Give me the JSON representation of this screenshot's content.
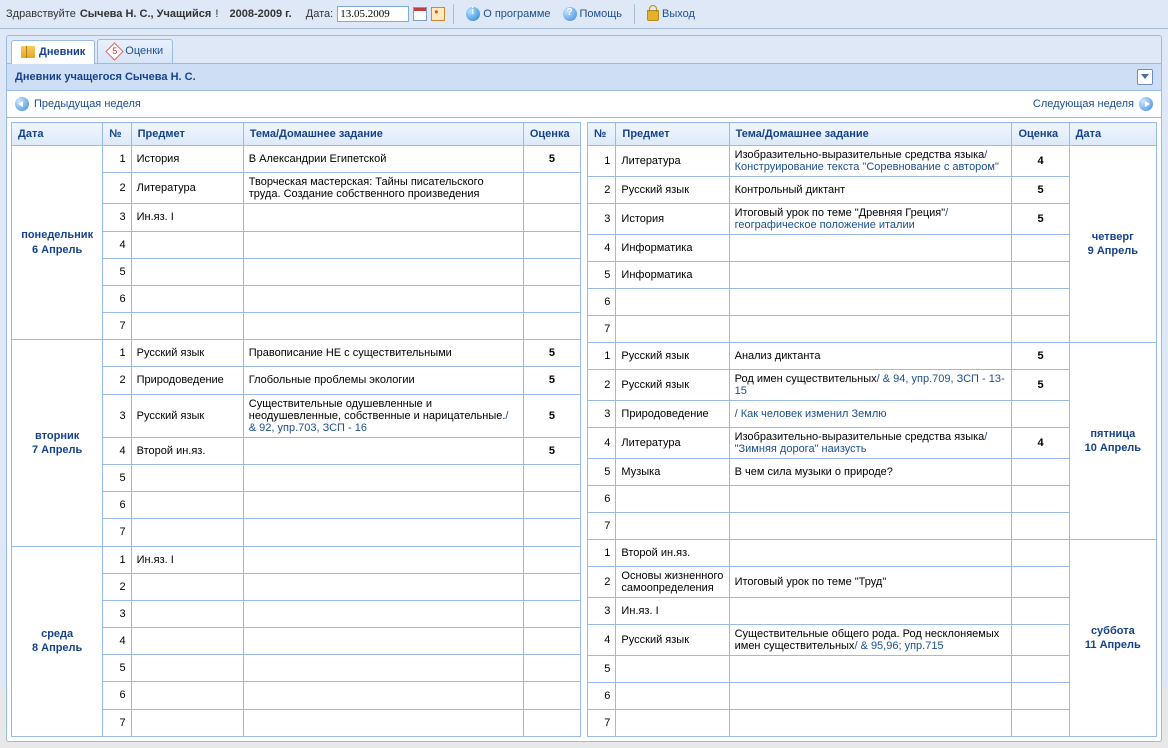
{
  "topbar": {
    "greeting_pre": "Здравствуйте ",
    "user": "Сычева Н. С., Учащийся",
    "greeting_post": "!",
    "year": "2008-2009 г.",
    "date_label": "Дата:",
    "date_value": "13.05.2009",
    "about": "О программе",
    "help": "Помощь",
    "exit": "Выход"
  },
  "tabs": {
    "diary": "Дневник",
    "grades": "Оценки"
  },
  "panel": {
    "title": "Дневник учащегося Сычева Н. С."
  },
  "nav": {
    "prev": "Предыдущая неделя",
    "next": "Следующая неделя"
  },
  "cols": {
    "date": "Дата",
    "num": "№",
    "subj": "Предмет",
    "topic": "Тема/Домашнее задание",
    "grade": "Оценка"
  },
  "left": [
    {
      "day": "понедельник",
      "date": "6 Апрель",
      "rows": [
        {
          "n": 1,
          "s": "История",
          "t": "В Александрии Египетской",
          "g": "5"
        },
        {
          "n": 2,
          "s": "Литература",
          "t": "Творческая мастерская: Тайны писательского труда. Создание собственного произведения",
          "g": ""
        },
        {
          "n": 3,
          "s": "Ин.яз. I",
          "t": "",
          "g": ""
        },
        {
          "n": 4,
          "s": "",
          "t": "",
          "g": ""
        },
        {
          "n": 5,
          "s": "",
          "t": "",
          "g": ""
        },
        {
          "n": 6,
          "s": "",
          "t": "",
          "g": ""
        },
        {
          "n": 7,
          "s": "",
          "t": "",
          "g": ""
        }
      ]
    },
    {
      "day": "вторник",
      "date": "7 Апрель",
      "rows": [
        {
          "n": 1,
          "s": "Русский язык",
          "t": "Правописание НЕ с существительными",
          "g": "5"
        },
        {
          "n": 2,
          "s": "Природоведение",
          "t": "Глобольные проблемы экологии",
          "g": "5"
        },
        {
          "n": 3,
          "s": "Русский язык",
          "t": "Существительные одушевленные и неодушевленные, собственные и нарицательные.",
          "hw": "/ & 92, упр.703, ЗСП - 16",
          "g": "5"
        },
        {
          "n": 4,
          "s": "Второй ин.яз.",
          "t": "",
          "g": "5"
        },
        {
          "n": 5,
          "s": "",
          "t": "",
          "g": ""
        },
        {
          "n": 6,
          "s": "",
          "t": "",
          "g": ""
        },
        {
          "n": 7,
          "s": "",
          "t": "",
          "g": ""
        }
      ]
    },
    {
      "day": "среда",
      "date": "8 Апрель",
      "rows": [
        {
          "n": 1,
          "s": "Ин.яз. I",
          "t": "",
          "g": ""
        },
        {
          "n": 2,
          "s": "",
          "t": "",
          "g": ""
        },
        {
          "n": 3,
          "s": "",
          "t": "",
          "g": ""
        },
        {
          "n": 4,
          "s": "",
          "t": "",
          "g": ""
        },
        {
          "n": 5,
          "s": "",
          "t": "",
          "g": ""
        },
        {
          "n": 6,
          "s": "",
          "t": "",
          "g": ""
        },
        {
          "n": 7,
          "s": "",
          "t": "",
          "g": ""
        }
      ]
    }
  ],
  "right": [
    {
      "day": "четверг",
      "date": "9 Апрель",
      "rows": [
        {
          "n": 1,
          "s": "Литература",
          "t": "Изобразительно-выразительные средства языка",
          "hw": "/ Конструирование текста \"Соревнование с автором\"",
          "g": "4"
        },
        {
          "n": 2,
          "s": "Русский язык",
          "t": "Контрольный диктант",
          "g": "5"
        },
        {
          "n": 3,
          "s": "История",
          "t": "Итоговый урок по теме \"Древняя Греция\"",
          "hw": "/ географическое положение италии",
          "g": "5"
        },
        {
          "n": 4,
          "s": "Информатика",
          "t": "",
          "g": ""
        },
        {
          "n": 5,
          "s": "Информатика",
          "t": "",
          "g": ""
        },
        {
          "n": 6,
          "s": "",
          "t": "",
          "g": ""
        },
        {
          "n": 7,
          "s": "",
          "t": "",
          "g": ""
        }
      ]
    },
    {
      "day": "пятница",
      "date": "10 Апрель",
      "rows": [
        {
          "n": 1,
          "s": "Русский язык",
          "t": "Анализ диктанта",
          "g": "5"
        },
        {
          "n": 2,
          "s": "Русский язык",
          "t": "Род имен существительных",
          "hw": "/ & 94, упр.709, ЗСП - 13-15",
          "g": "5"
        },
        {
          "n": 3,
          "s": "Природоведение",
          "t": "",
          "hw": "/ Как человек изменил Землю",
          "g": ""
        },
        {
          "n": 4,
          "s": "Литература",
          "t": "Изобразительно-выразительные средства языка",
          "hw": "/ \"Зимняя дорога\" наизусть",
          "g": "4"
        },
        {
          "n": 5,
          "s": "Музыка",
          "t": "В чем сила музыки о природе?",
          "g": ""
        },
        {
          "n": 6,
          "s": "",
          "t": "",
          "g": ""
        },
        {
          "n": 7,
          "s": "",
          "t": "",
          "g": ""
        }
      ]
    },
    {
      "day": "суббота",
      "date": "11 Апрель",
      "rows": [
        {
          "n": 1,
          "s": "Второй ин.яз.",
          "t": "",
          "g": ""
        },
        {
          "n": 2,
          "s": "Основы жизненного самоопределения",
          "t": "Итоговый урок по теме \"Труд\"",
          "g": ""
        },
        {
          "n": 3,
          "s": "Ин.яз. I",
          "t": "",
          "g": ""
        },
        {
          "n": 4,
          "s": "Русский язык",
          "t": "Существительные общего рода. Род несклоняемых имен существительных",
          "hw": "/ & 95,96; упр.715",
          "g": ""
        },
        {
          "n": 5,
          "s": "",
          "t": "",
          "g": ""
        },
        {
          "n": 6,
          "s": "",
          "t": "",
          "g": ""
        },
        {
          "n": 7,
          "s": "",
          "t": "",
          "g": ""
        }
      ]
    }
  ]
}
